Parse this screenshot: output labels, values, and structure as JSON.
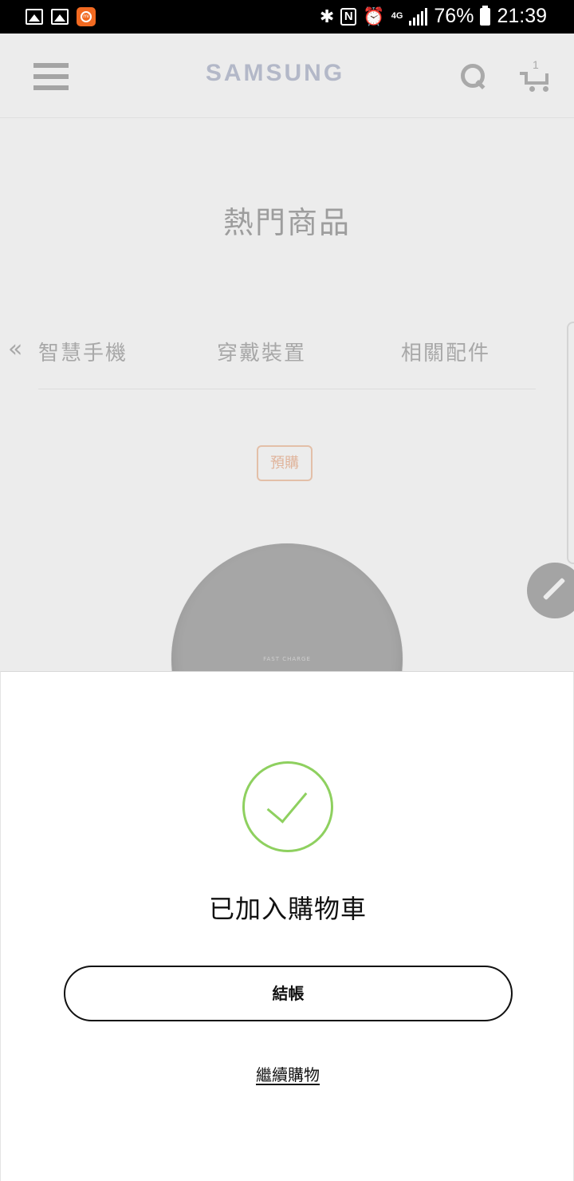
{
  "status_bar": {
    "battery": "76%",
    "time": "21:39",
    "network": "4G",
    "mi_badge": "mi"
  },
  "header": {
    "logo": "SAMSUNG",
    "cart_count": "1"
  },
  "page": {
    "section_title": "熱門商品",
    "tabs_back_glyph": "«",
    "tabs": [
      {
        "label": "智慧手機"
      },
      {
        "label": "穿戴裝置"
      },
      {
        "label": "相關配件"
      }
    ],
    "product_badge": "預購",
    "product_print": "FAST CHARGE"
  },
  "dialog": {
    "title": "已加入購物車",
    "checkout_label": "結帳",
    "continue_label": "繼續購物"
  },
  "colors": {
    "success": "#8ed05f",
    "badge": "#e0b49b",
    "overlay": "#ececec"
  }
}
